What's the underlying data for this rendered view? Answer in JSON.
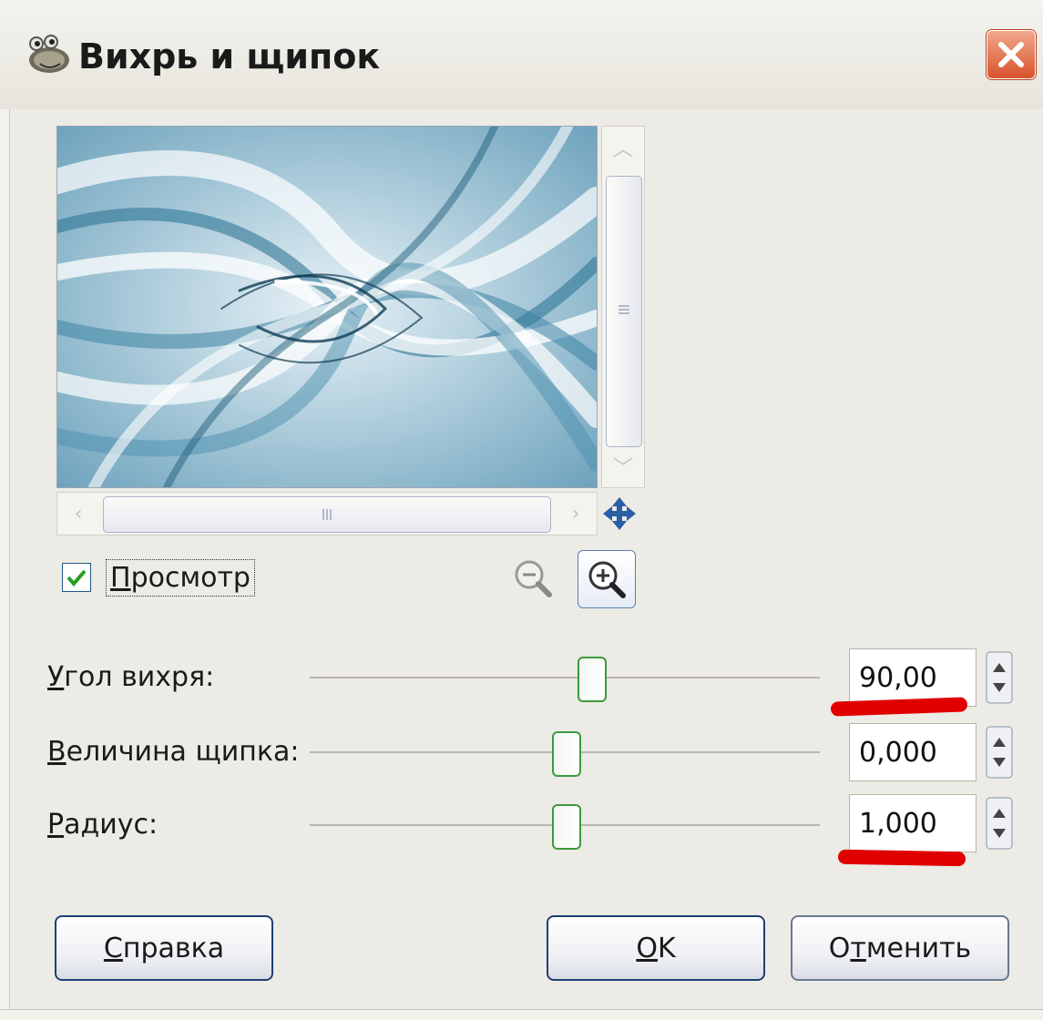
{
  "window": {
    "title": "Вихрь и щипок",
    "close_icon": "close-icon"
  },
  "preview": {
    "checkbox_checked": true,
    "checkbox_label_first": "П",
    "checkbox_label_rest": "росмотр"
  },
  "params": [
    {
      "label_first": "У",
      "label_rest": "гол вихря:",
      "value": "90,00",
      "slider_fraction": 0.55
    },
    {
      "label_first": "В",
      "label_rest": "еличина щипка:",
      "value": "0,000",
      "slider_fraction": 0.5
    },
    {
      "label_first": "Р",
      "label_rest": "адиус:",
      "value": "1,000",
      "slider_fraction": 0.5
    }
  ],
  "buttons": {
    "help_first": "С",
    "help_rest": "правка",
    "ok_first": "O",
    "ok_rest": "K",
    "cancel_pre": "О",
    "cancel_u": "т",
    "cancel_rest": "менить"
  },
  "colors": {
    "accent_red": "#e00000",
    "slider_green": "#3c9a3e"
  }
}
